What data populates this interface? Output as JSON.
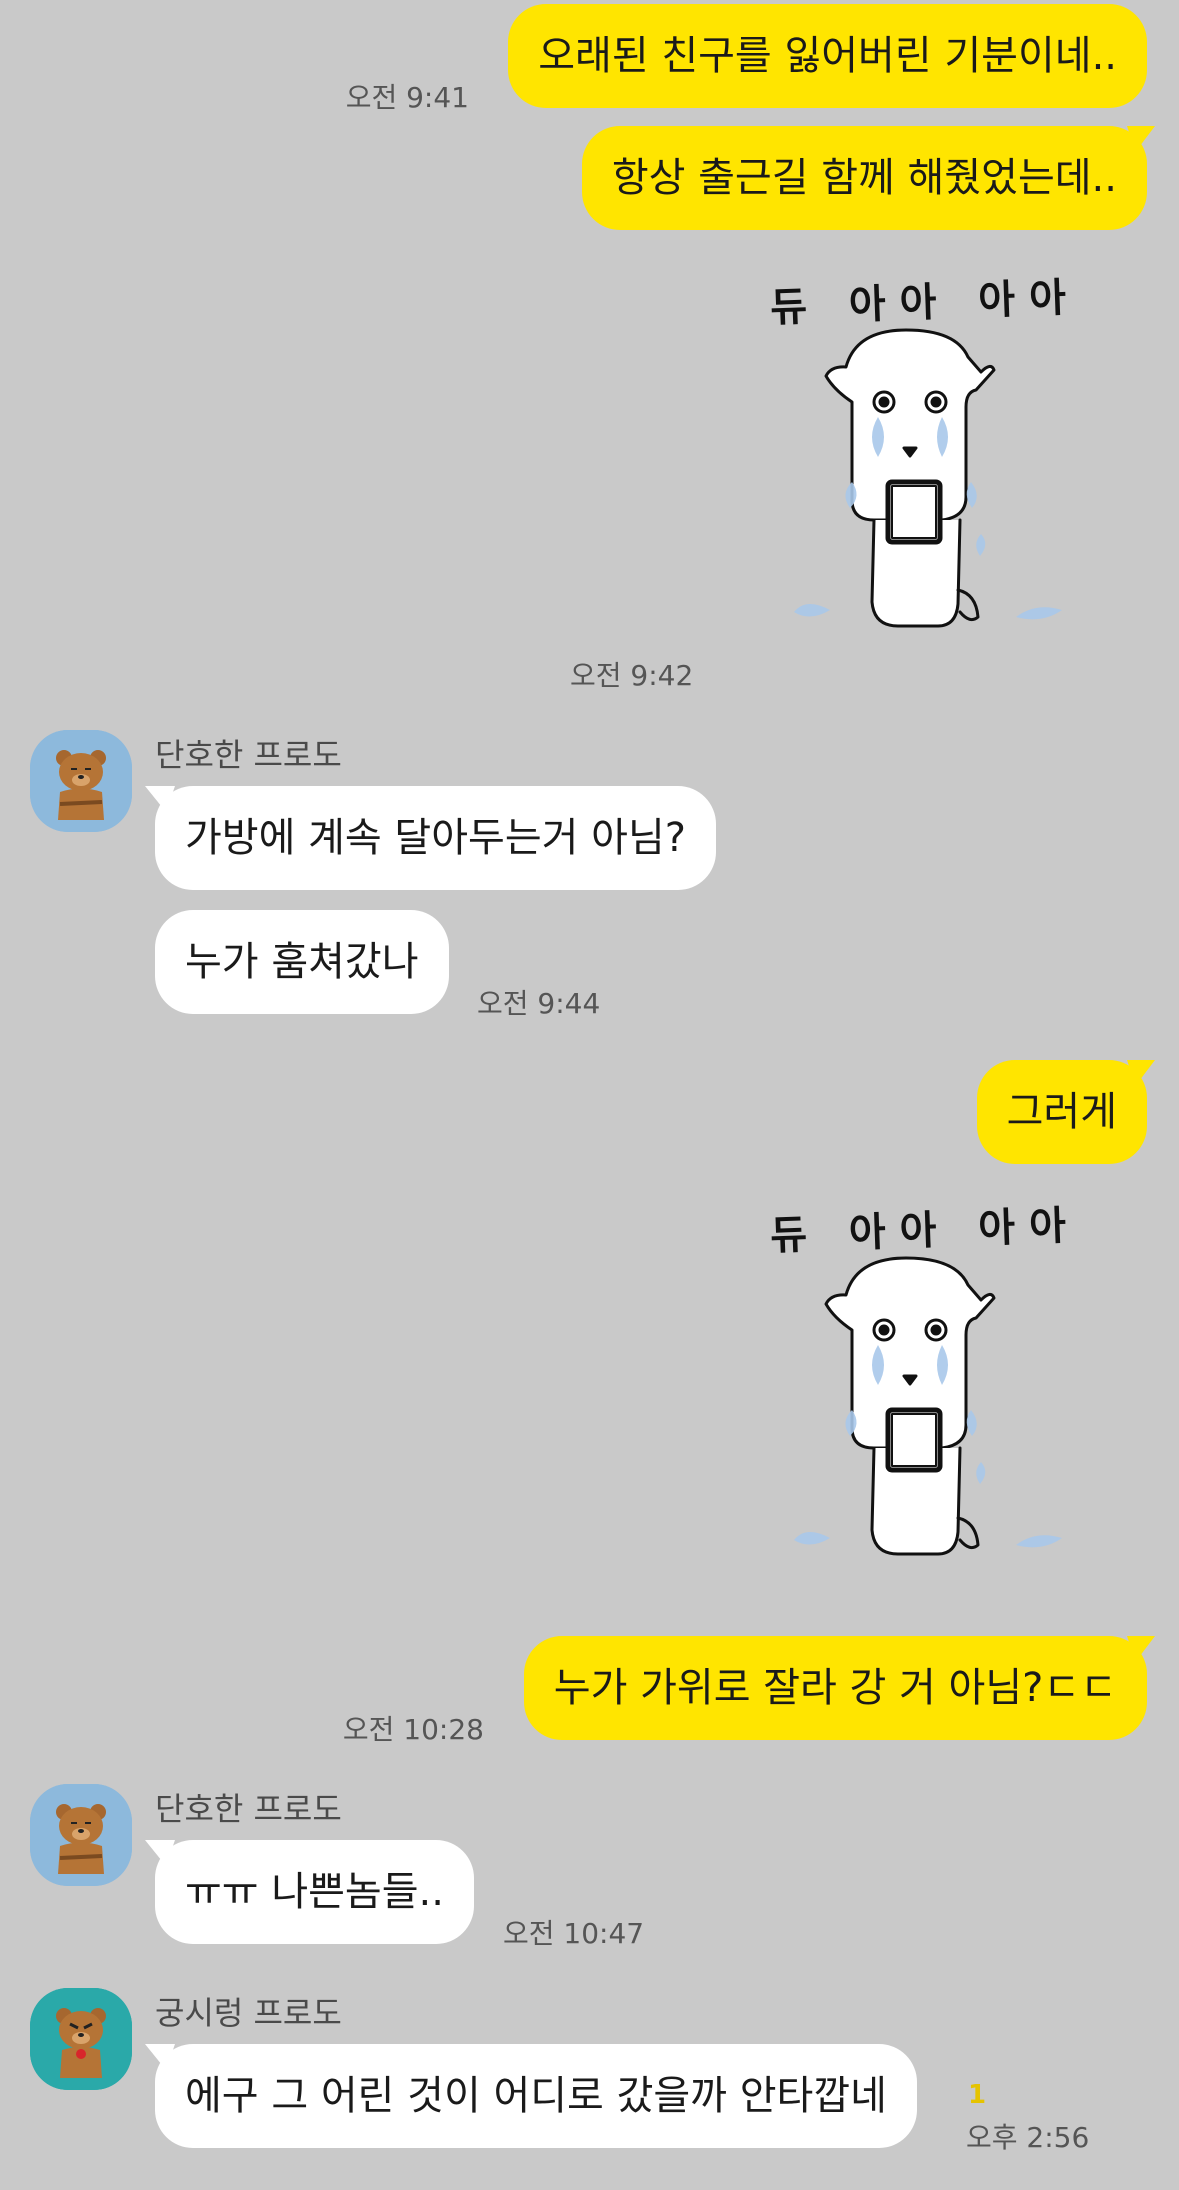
{
  "colors": {
    "background": "#c9c9c9",
    "my_bubble": "#ffe500",
    "their_bubble": "#ffffff",
    "unread": "#e5c300"
  },
  "messages": {
    "m1": {
      "text": "오래된 친구를 잃어버린 기분이네..",
      "time": "오전 9:41"
    },
    "m2": {
      "text": "항상 출근길 함께 해줬었는데.."
    },
    "sticker1": {
      "caption": "듀 아아 아아",
      "time": "오전 9:42",
      "icon": "crying-dog-sticker"
    },
    "f1": {
      "sender": "단호한 프로도",
      "avatar": "frodo-arms-crossed-avatar"
    },
    "m3": {
      "text": "가방에 계속 달아두는거 아님?"
    },
    "m4": {
      "text": "누가 훔쳐갔나",
      "time": "오전 9:44"
    },
    "m5": {
      "text": "그러게"
    },
    "sticker2": {
      "caption": "듀 아아 아아",
      "icon": "crying-dog-sticker"
    },
    "m6": {
      "text": "누가 가위로 잘라 강 거 아님?ㄷㄷ",
      "time": "오전 10:28"
    },
    "f2": {
      "sender": "단호한 프로도",
      "avatar": "frodo-arms-crossed-avatar"
    },
    "m7": {
      "text": "ㅠㅠ 나쁜놈들..",
      "time": "오전 10:47"
    },
    "f3": {
      "sender": "궁시렁 프로도",
      "avatar": "frodo-grumbling-avatar"
    },
    "m8": {
      "text": "에구 그 어린 것이 어디로 갔을까 안타깝네",
      "time": "오후 2:56",
      "unread": "1"
    }
  }
}
